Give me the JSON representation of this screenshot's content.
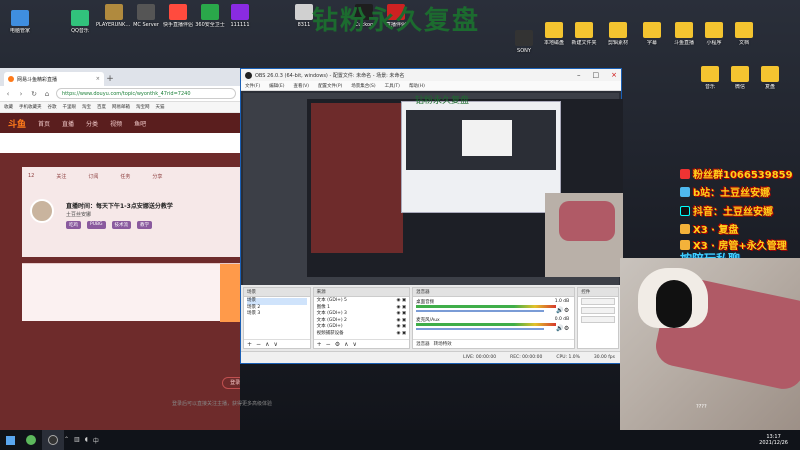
{
  "overlay": {
    "watermark": "钻粉永久复盘",
    "fan_group": "粉丝群1066539859",
    "bilibili": "b站：土豆丝安娜",
    "douyin": "抖音：土豆丝安娜",
    "x3_a": "X3 · 复盘",
    "x3_b": "X3 · 房管+永久管理",
    "footer_promo": "按陪玩私聊",
    "webcam_text": "????"
  },
  "desktop_icons": [
    {
      "label": "电脑管家",
      "color": "#3f8ee0"
    },
    {
      "label": "QQ音乐",
      "color": "#31c27c"
    },
    {
      "label": "PLAYERUNKNOWN'S BATTLEGROUNDS",
      "color": "#b08a3e"
    },
    {
      "label": "MC Server",
      "color": "#555555"
    },
    {
      "label": "快手直播伴侣",
      "color": "#ff4b3e"
    },
    {
      "label": "360安全卫士",
      "color": "#2aa84a"
    },
    {
      "label": "111111",
      "color": "#8a2be2"
    },
    {
      "label": "8311",
      "color": "#d0d0d0"
    },
    {
      "label": "Cuckoo",
      "color": "#1e1e1e"
    },
    {
      "label": "直播伴侣",
      "color": "#cc2222"
    },
    {
      "label": "SONY",
      "color": "#333333"
    },
    {
      "label": "本地磁盘",
      "color": "#f4c430"
    },
    {
      "label": "新建文件夹",
      "color": "#f4c430"
    },
    {
      "label": "剪辑素材",
      "color": "#f4c430"
    },
    {
      "label": "字幕",
      "color": "#f4c430"
    },
    {
      "label": "斗鱼直播",
      "color": "#f4c430"
    },
    {
      "label": "小程序",
      "color": "#f4c430"
    },
    {
      "label": "文档",
      "color": "#f4c430"
    },
    {
      "label": "音乐",
      "color": "#f4c430"
    },
    {
      "label": "微信",
      "color": "#f4c430"
    },
    {
      "label": "复盘",
      "color": "#f4c430"
    }
  ],
  "browser": {
    "tab_title": "网易斗鱼精彩直播",
    "url": "https://www.douyu.com/topic/wyonthk_47rid=7240",
    "bookmarks": [
      "收藏",
      "手机收藏夹",
      "谷歌",
      "千里眼",
      "淘宝",
      "百度",
      "网易邮箱",
      "淘宝网",
      "天猫"
    ],
    "site_nav": [
      "斗鱼",
      "首页",
      "直播",
      "分类",
      "视频",
      "鱼吧"
    ],
    "panel_items": [
      "12",
      "关注",
      "订阅",
      "任务",
      "分享"
    ],
    "stream_title": "直播时间：每天下午1-3点安娜送分教学",
    "streamer_name": "土豆丝安娜",
    "tags": [
      "吃鸡",
      "PUBG",
      "技术流",
      "教学"
    ],
    "login_button": "登录/注册",
    "login_hint": "登录后可以直接关注主播，获得更多高级体验"
  },
  "obs": {
    "title": "OBS 26.0.3 (64-bit, windows) - 配置文件: 未命名 - 场景: 未命名",
    "menu": [
      "文件(F)",
      "编辑(E)",
      "查看(V)",
      "配置文件(P)",
      "场景集合(S)",
      "工具(T)",
      "帮助(H)"
    ],
    "preview_watermark": "钻粉永久复盘",
    "scenes_header": "场景",
    "scenes": [
      "场景",
      "场景 2",
      "场景 3"
    ],
    "sources_header": "来源",
    "sources": [
      "文本 (GDI+) 5",
      "图像 1",
      "文本 (GDI+) 3",
      "文本 (GDI+) 2",
      "文本 (GDI+)",
      "视频捕获设备"
    ],
    "mixer_header": "混音器",
    "mixer": [
      {
        "name": "桌面音频",
        "db": "1.0 dB"
      },
      {
        "name": "麦克风/Aux",
        "db": "0.0 dB"
      }
    ],
    "transitions_header": "转场特效",
    "controls_header": "控件",
    "dock_footer_tabs": [
      "混音器",
      "转场特效"
    ],
    "status": {
      "live": "LIVE: 00:00:00",
      "rec": "REC: 00:00:00",
      "cpu": "CPU: 1.0%",
      "fps": "30.00 fps"
    }
  },
  "taskbar": {
    "time": "13:17",
    "date": "2021/12/26"
  }
}
